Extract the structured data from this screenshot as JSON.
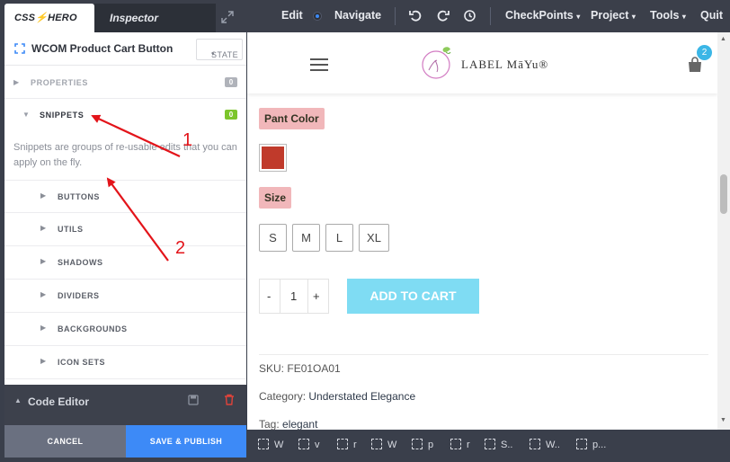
{
  "topbar": {
    "brand_tab": "CSS⚡HERO",
    "inspector_tab": "Inspector",
    "edit_label": "Edit",
    "navigate_label": "Navigate",
    "checkpoints_label": "CheckPoints",
    "project_label": "Project",
    "tools_label": "Tools",
    "quit_label": "Quit",
    "dropdown_glyph": "▾"
  },
  "panel": {
    "element_name": "WCOM Product Cart Button",
    "state_label": "STATE",
    "properties_label": "PROPERTIES",
    "properties_count": "0",
    "snippets_label": "SNIPPETS",
    "snippets_count": "0",
    "snippets_description": "Snippets are groups of re-usable edits that you can apply on the fly.",
    "snippet_groups": [
      "BUTTONS",
      "UTILS",
      "SHADOWS",
      "DIVIDERS",
      "BACKGROUNDS",
      "ICON SETS"
    ],
    "code_editor_label": "Code Editor",
    "cancel_label": "CANCEL",
    "save_label": "SAVE & PUBLISH"
  },
  "preview": {
    "logo_text": "LABEL MāYu®",
    "cart_count": "2",
    "pant_color_label": "Pant Color",
    "swatch_color": "#c03a2b",
    "size_label": "Size",
    "sizes": [
      "S",
      "M",
      "L",
      "XL"
    ],
    "qty_minus": "-",
    "qty_value": "1",
    "qty_plus": "+",
    "add_to_cart": "ADD TO CART",
    "sku_label": "SKU:",
    "sku_value": "FE01OA01",
    "category_label": "Category:",
    "category_value": "Understated Elegance",
    "tag_label": "Tag:",
    "tag_value": "elegant"
  },
  "breadcrumbs": [
    "W",
    "v",
    "r",
    "W",
    "p",
    "r",
    "S..",
    "W..",
    "p..."
  ],
  "annotations": [
    "1",
    "2"
  ],
  "colors": {
    "accent_blue": "#3d8af7",
    "badge_grey": "#b0b3ba",
    "badge_green": "#7cc52b",
    "label_pink": "#f1b7ba",
    "add_cart_blue": "#7fdcf3"
  }
}
